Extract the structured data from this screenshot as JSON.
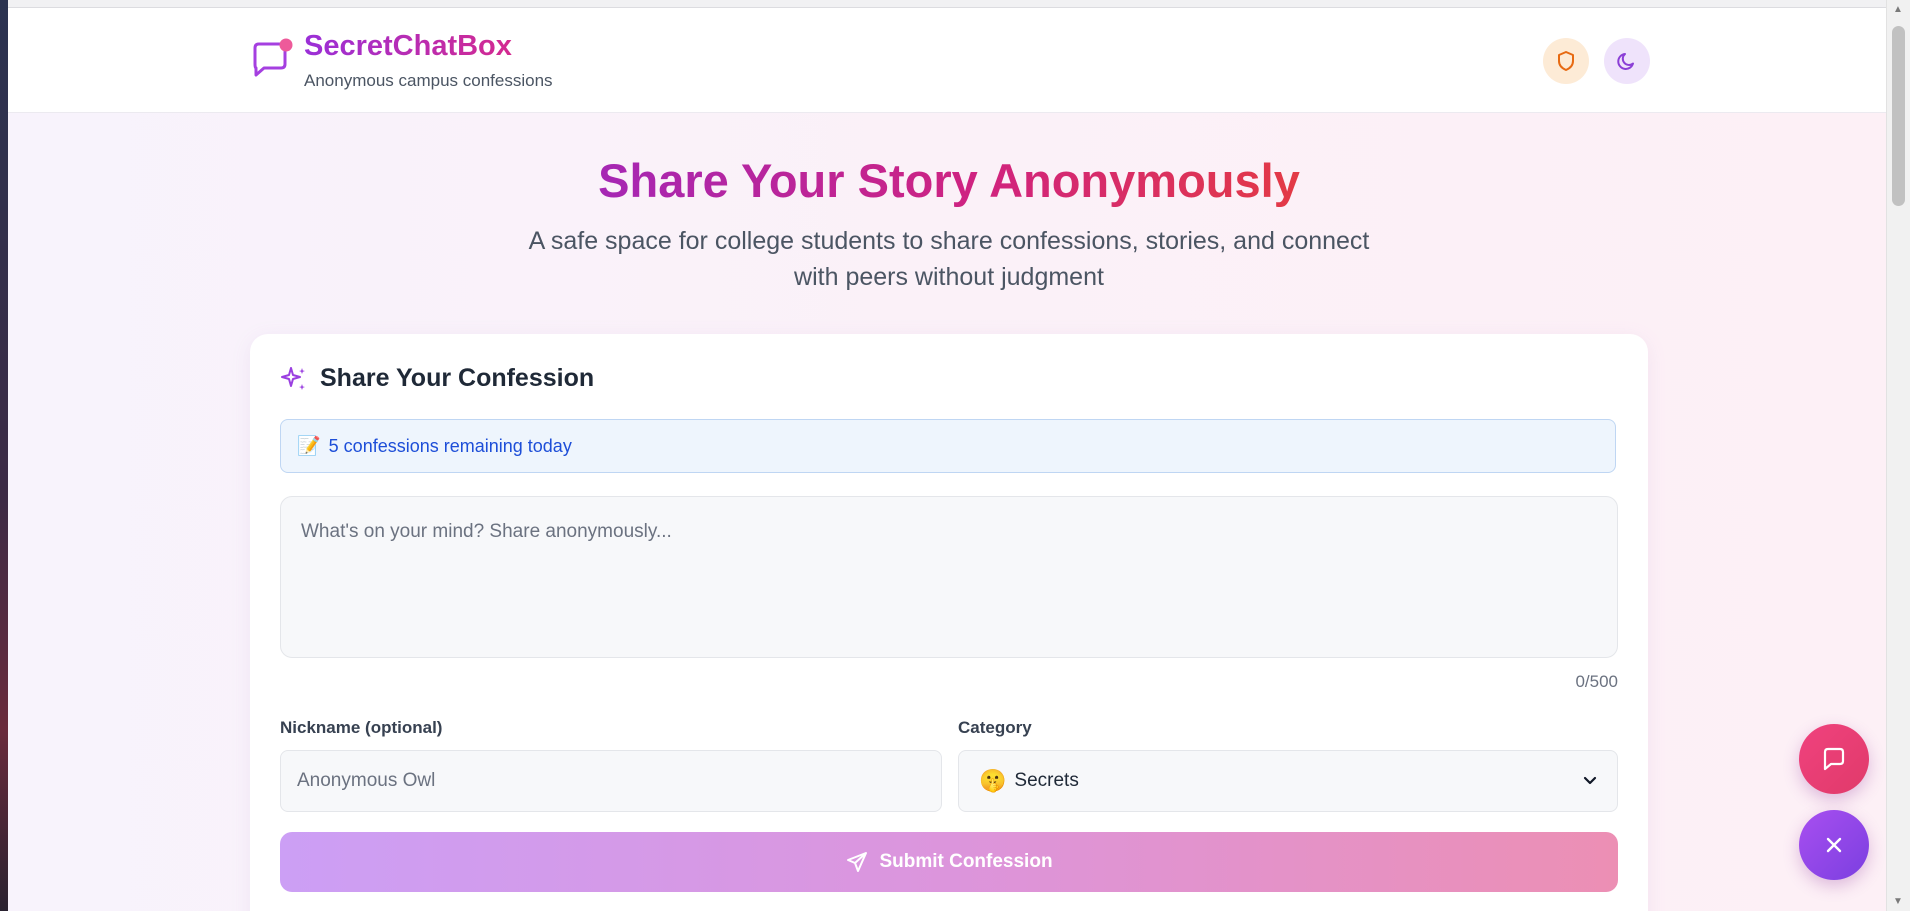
{
  "header": {
    "brand_name": "SecretChatBox",
    "brand_tagline": "Anonymous campus confessions",
    "privacy_icon": "shield-icon",
    "theme_icon": "moon-icon"
  },
  "hero": {
    "title": "Share Your Story Anonymously",
    "subtitle": "A safe space for college students to share confessions, stories, and connect with peers without judgment"
  },
  "form": {
    "title": "Share Your Confession",
    "title_icon": "sparkles-icon",
    "remaining_emoji": "📝",
    "remaining_text": "5 confessions remaining today",
    "confession_placeholder": "What's on your mind? Share anonymously...",
    "confession_value": "",
    "char_counter": "0/500",
    "nickname_label": "Nickname (optional)",
    "nickname_placeholder": "Anonymous Owl",
    "category_label": "Category",
    "category_emoji": "🤫",
    "category_value": "Secrets",
    "submit_label": "Submit Confession",
    "submit_icon": "send-icon"
  },
  "floating": {
    "chat_icon": "chat-bubble-icon",
    "close_icon": "close-icon"
  },
  "colors": {
    "brand_purple": "#9a2fd8",
    "brand_pink": "#d42a8f",
    "info_blue": "#1d4ed8",
    "fab_pink": "#f0427e",
    "fab_purple": "#a84ff0"
  }
}
